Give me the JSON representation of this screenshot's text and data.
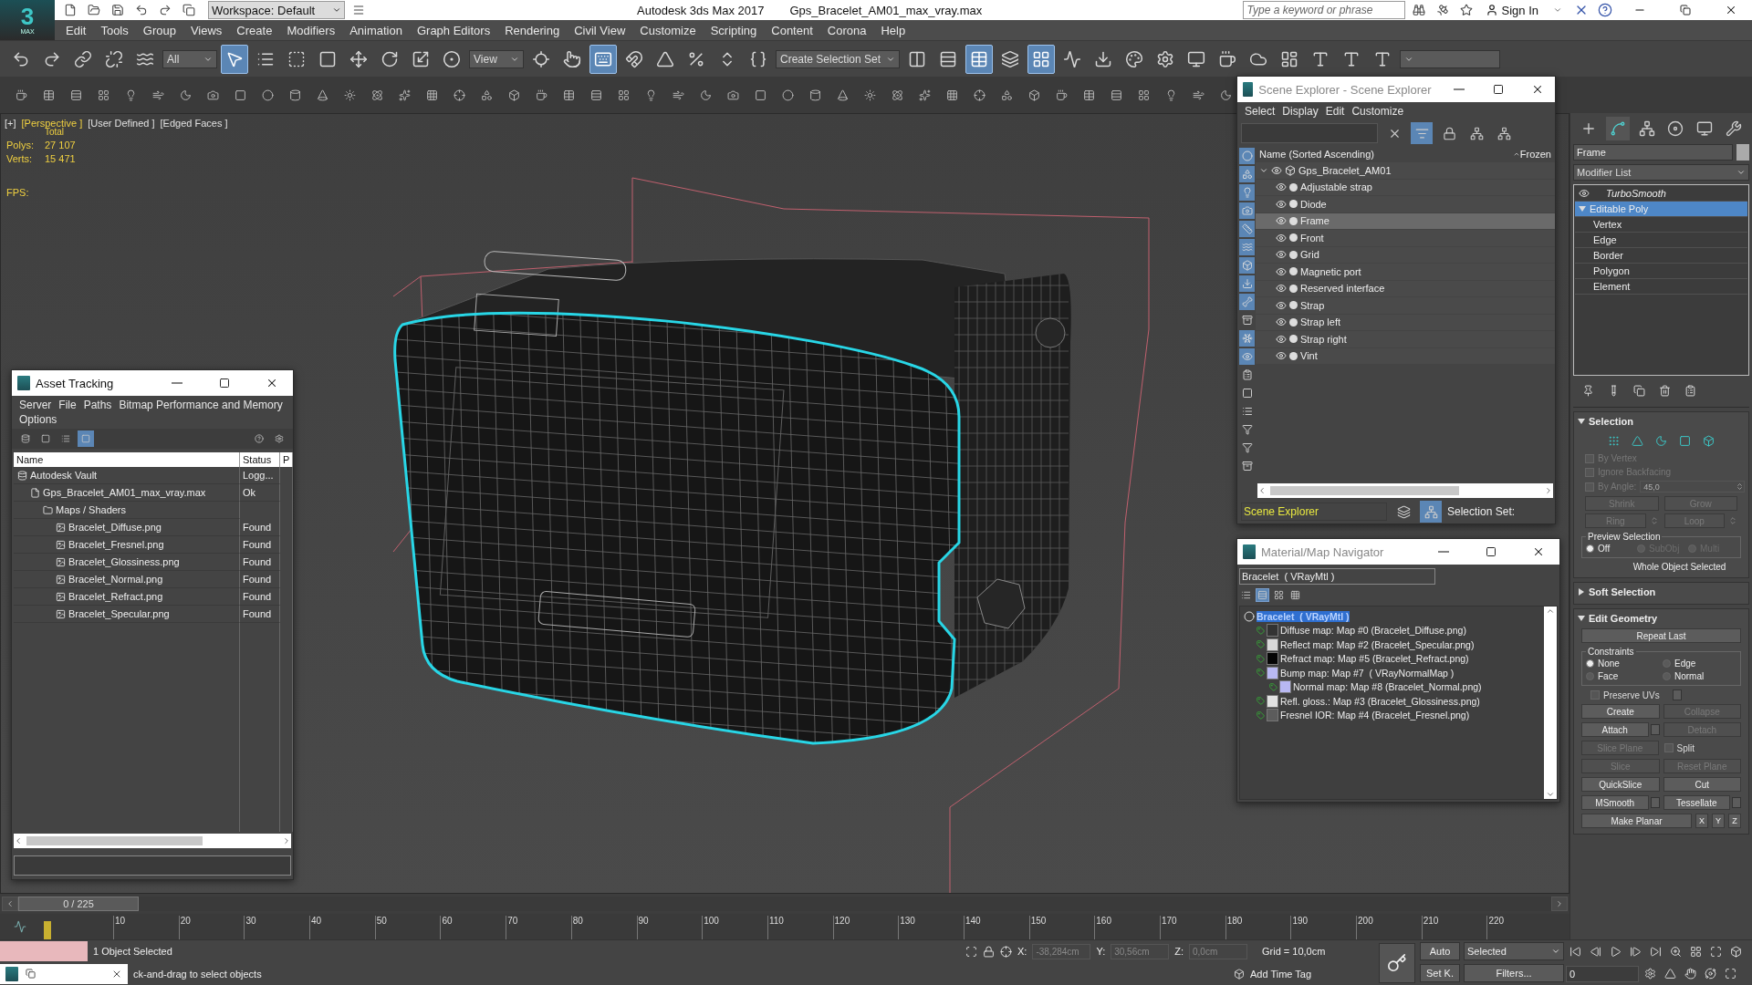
{
  "app": {
    "logo": "3",
    "logo_caption": "MAX",
    "workspace": "Workspace: Default",
    "title": "Autodesk 3ds Max 2017",
    "file": "Gps_Bracelet_AM01_max_vray.max",
    "search": {
      "placeholder": "Type a keyword or phrase"
    },
    "sign_in": "Sign In"
  },
  "menu": [
    "Edit",
    "Tools",
    "Group",
    "Views",
    "Create",
    "Modifiers",
    "Animation",
    "Graph Editors",
    "Rendering",
    "Civil View",
    "Customize",
    "Scripting",
    "Content",
    "Corona",
    "Help"
  ],
  "main_toolbar": [
    {
      "kind": "button",
      "selected": false
    },
    {
      "kind": "button",
      "selected": false
    },
    {
      "kind": "button",
      "selected": false
    },
    {
      "kind": "button",
      "selected": false
    },
    {
      "kind": "button",
      "selected": false
    },
    {
      "kind": "dropdown",
      "value": "All"
    },
    {
      "kind": "button",
      "selected": true
    },
    {
      "kind": "button",
      "selected": false
    },
    {
      "kind": "button",
      "selected": false
    },
    {
      "kind": "button",
      "selected": false
    },
    {
      "kind": "button",
      "selected": false
    },
    {
      "kind": "button",
      "selected": false
    },
    {
      "kind": "button",
      "selected": false
    },
    {
      "kind": "button",
      "selected": false
    },
    {
      "kind": "dropdown",
      "value": "View"
    },
    {
      "kind": "button",
      "selected": false
    },
    {
      "kind": "button",
      "selected": false
    },
    {
      "kind": "button",
      "selected": true
    },
    {
      "kind": "button",
      "selected": false
    },
    {
      "kind": "button",
      "selected": false
    },
    {
      "kind": "button",
      "selected": false
    },
    {
      "kind": "button",
      "selected": false
    },
    {
      "kind": "button",
      "selected": false
    },
    {
      "kind": "dropdown",
      "value": "Create Selection Set"
    },
    {
      "kind": "button",
      "selected": false
    },
    {
      "kind": "button",
      "selected": false
    },
    {
      "kind": "button",
      "selected": true
    },
    {
      "kind": "button",
      "selected": false
    },
    {
      "kind": "button",
      "selected": true
    },
    {
      "kind": "button",
      "selected": false
    },
    {
      "kind": "button",
      "selected": false
    },
    {
      "kind": "button",
      "selected": false
    },
    {
      "kind": "button",
      "selected": false
    },
    {
      "kind": "button",
      "selected": false
    },
    {
      "kind": "button",
      "selected": false
    },
    {
      "kind": "button",
      "selected": false
    },
    {
      "kind": "button",
      "selected": false
    },
    {
      "kind": "button",
      "selected": false
    },
    {
      "kind": "button",
      "selected": false
    },
    {
      "kind": "button",
      "selected": false
    },
    {
      "kind": "dropdown"
    }
  ],
  "viewport": {
    "labels": [
      {
        "text": "[+]",
        "selected": false
      },
      {
        "text": "[Perspective ]",
        "selected": true
      },
      {
        "text": "[User Defined ]",
        "selected": false
      },
      {
        "text": "[Edged Faces ]",
        "selected": false
      }
    ],
    "stats_title": "Total",
    "stats": [
      {
        "label": "Polys:",
        "value": "27 107"
      },
      {
        "label": "Verts:",
        "value": "15 471"
      }
    ],
    "fps": "FPS:"
  },
  "asset_tracking": {
    "title": "Asset Tracking",
    "menu": [
      "Server",
      "File",
      "Paths",
      "Bitmap Performance and Memory",
      "Options"
    ],
    "toolbar": [
      {
        "selected": false
      },
      {
        "selected": false
      },
      {
        "selected": false
      },
      {
        "selected": true
      },
      {
        "selected": false
      },
      {
        "selected": false
      }
    ],
    "columns": [
      "Name",
      "Status",
      "P"
    ],
    "tree": [
      {
        "kind": "vault",
        "name": "Autodesk Vault",
        "status": "Logg...",
        "children": [
          {
            "kind": "scene",
            "name": "Gps_Bracelet_AM01_max_vray.max",
            "status": "Ok",
            "children": [
              {
                "kind": "folder",
                "name": "Maps / Shaders",
                "children": [
                  {
                    "kind": "bitmap",
                    "name": "Bracelet_Diffuse.png",
                    "status": "Found"
                  },
                  {
                    "kind": "bitmap",
                    "name": "Bracelet_Fresnel.png",
                    "status": "Found"
                  },
                  {
                    "kind": "bitmap",
                    "name": "Bracelet_Glossiness.png",
                    "status": "Found"
                  },
                  {
                    "kind": "bitmap",
                    "name": "Bracelet_Normal.png",
                    "status": "Found"
                  },
                  {
                    "kind": "bitmap",
                    "name": "Bracelet_Refract.png",
                    "status": "Found"
                  },
                  {
                    "kind": "bitmap",
                    "name": "Bracelet_Specular.png",
                    "status": "Found"
                  }
                ]
              }
            ]
          }
        ]
      }
    ]
  },
  "scene_explorer": {
    "title": "Scene Explorer - Scene Explorer",
    "menu": [
      "Select",
      "Display",
      "Edit",
      "Customize"
    ],
    "tools": [
      {
        "selected": false
      },
      {
        "selected": true
      },
      {
        "selected": false
      },
      {
        "selected": false
      },
      {
        "selected": false
      }
    ],
    "side_filters": [
      {
        "selected": true
      },
      {
        "selected": true
      },
      {
        "selected": true
      },
      {
        "selected": true
      },
      {
        "selected": true
      },
      {
        "selected": true
      },
      {
        "selected": true
      },
      {
        "selected": true
      },
      {
        "selected": true
      },
      {
        "selected": false
      },
      {
        "selected": true
      },
      {
        "selected": true
      },
      {
        "selected": false
      },
      {
        "selected": false
      },
      {
        "selected": false
      },
      {
        "selected": false
      },
      {
        "selected": false
      },
      {
        "selected": false
      }
    ],
    "columns": [
      "Name (Sorted Ascending)",
      "Frozen"
    ],
    "tree": [
      {
        "name": "Gps_Bracelet_AM01",
        "kind": "group",
        "expanded": true,
        "selected": false,
        "children": [
          {
            "name": "Adjustable strap",
            "kind": "object",
            "selected": false
          },
          {
            "name": "Diode",
            "kind": "object",
            "selected": false
          },
          {
            "name": "Frame",
            "kind": "object",
            "selected": true
          },
          {
            "name": "Front",
            "kind": "object",
            "selected": false
          },
          {
            "name": "Grid",
            "kind": "object",
            "selected": false
          },
          {
            "name": "Magnetic port",
            "kind": "object",
            "selected": false
          },
          {
            "name": "Reserved interface",
            "kind": "object",
            "selected": false
          },
          {
            "name": "Strap",
            "kind": "object",
            "selected": false
          },
          {
            "name": "Strap left",
            "kind": "object",
            "selected": false
          },
          {
            "name": "Strap right",
            "kind": "object",
            "selected": false
          },
          {
            "name": "Vint",
            "kind": "object",
            "selected": false
          }
        ]
      }
    ],
    "mode": "Scene Explorer",
    "footer_tools": [
      {
        "selected": false
      },
      {
        "selected": true
      }
    ],
    "selection_set": "Selection Set:"
  },
  "material_navigator": {
    "title": "Material/Map Navigator",
    "current": "Bracelet  ( VRayMtl )",
    "view_modes": [
      {
        "selected": false
      },
      {
        "selected": true
      },
      {
        "selected": false
      },
      {
        "selected": false
      }
    ],
    "tree": [
      {
        "name": "Bracelet  ( VRayMtl )",
        "kind": "material",
        "selected": true,
        "children": [
          {
            "name": "Diffuse map: Map #0 (Bracelet_Diffuse.png)",
            "kind": "map",
            "selected": false,
            "color": "#333333"
          },
          {
            "name": "Reflect map: Map #2 (Bracelet_Specular.png)",
            "kind": "map",
            "selected": false,
            "color": "#d8d8d8"
          },
          {
            "name": "Refract map: Map #5 (Bracelet_Refract.png)",
            "kind": "map",
            "selected": false,
            "color": "#050505"
          },
          {
            "name": "Bump map: Map #7  ( VRayNormalMap )",
            "kind": "map",
            "selected": false,
            "color": "#b8b8f2",
            "children": [
              {
                "name": "Normal map: Map #8 (Bracelet_Normal.png)",
                "kind": "map",
                "selected": false,
                "color": "#b8b8f2"
              }
            ]
          },
          {
            "name": "Refl. gloss.: Map #3 (Bracelet_Glossiness.png)",
            "kind": "map",
            "selected": false,
            "color": "#e2e2e2"
          },
          {
            "name": "Fresnel IOR: Map #4 (Bracelet_Fresnel.png)",
            "kind": "map",
            "selected": false,
            "color": "#5c5c5c"
          }
        ]
      }
    ]
  },
  "command_panel": {
    "tabs": [
      {
        "selected": false
      },
      {
        "selected": true
      },
      {
        "selected": false
      },
      {
        "selected": false
      },
      {
        "selected": false
      },
      {
        "selected": false
      }
    ],
    "object_name": "Frame",
    "modifier_list": "Modifier List",
    "stack": [
      {
        "name": "TurboSmooth",
        "kind": "modifier",
        "selected": false
      },
      {
        "name": "Editable Poly",
        "kind": "base",
        "selected": true,
        "expanded": true,
        "children": [
          {
            "name": "Vertex",
            "selected": false
          },
          {
            "name": "Edge",
            "selected": false
          },
          {
            "name": "Border",
            "selected": false
          },
          {
            "name": "Polygon",
            "selected": false
          },
          {
            "name": "Element",
            "selected": false
          }
        ]
      }
    ],
    "selection": {
      "title": "Selection",
      "expanded": true,
      "checks": [
        {
          "label": "By Vertex",
          "checked": false,
          "disabled": true
        },
        {
          "label": "Ignore Backfacing",
          "checked": false,
          "disabled": true
        },
        {
          "label": "By Angle:",
          "checked": false,
          "disabled": true,
          "value": "45,0"
        }
      ],
      "buttons": [
        {
          "label": "Shrink",
          "disabled": true,
          "spinner": false
        },
        {
          "label": "Grow",
          "disabled": true,
          "spinner": false
        },
        {
          "label": "Ring",
          "disabled": true,
          "spinner": true
        },
        {
          "label": "Loop",
          "disabled": true,
          "spinner": true
        }
      ],
      "preview": {
        "title": "Preview Selection",
        "options": [
          {
            "label": "Off",
            "selected": true,
            "disabled": false
          },
          {
            "label": "SubObj",
            "selected": false,
            "disabled": true
          },
          {
            "label": "Multi",
            "selected": false,
            "disabled": true
          }
        ]
      },
      "status": "Whole Object Selected"
    },
    "soft_selection": {
      "title": "Soft Selection",
      "expanded": false
    },
    "edit_geometry": {
      "title": "Edit Geometry",
      "expanded": true,
      "repeat_last": "Repeat Last",
      "constraints": {
        "title": "Constraints",
        "options": [
          {
            "label": "None",
            "selected": true
          },
          {
            "label": "Edge",
            "selected": false
          },
          {
            "label": "Face",
            "selected": false
          },
          {
            "label": "Normal",
            "selected": false
          }
        ]
      },
      "preserve_uvs": {
        "label": "Preserve UVs",
        "checked": false,
        "settings": true
      },
      "rows": [
        [
          {
            "kind": "button",
            "label": "Create",
            "disabled": false,
            "settings": false
          },
          {
            "kind": "button",
            "label": "Collapse",
            "disabled": true,
            "settings": false
          }
        ],
        [
          {
            "kind": "button",
            "label": "Attach",
            "disabled": false,
            "settings": true
          },
          {
            "kind": "button",
            "label": "Detach",
            "disabled": true,
            "settings": false
          }
        ],
        [
          {
            "kind": "button",
            "label": "Slice Plane",
            "disabled": true,
            "settings": false
          },
          {
            "kind": "checkbox",
            "label": "Split",
            "checked": false,
            "disabled": false
          }
        ],
        [
          {
            "kind": "button",
            "label": "Slice",
            "disabled": true,
            "settings": false
          },
          {
            "kind": "button",
            "label": "Reset Plane",
            "disabled": true,
            "settings": false
          }
        ],
        [
          {
            "kind": "button",
            "label": "QuickSlice",
            "disabled": false,
            "settings": false
          },
          {
            "kind": "button",
            "label": "Cut",
            "disabled": false,
            "settings": false
          }
        ],
        [
          {
            "kind": "button",
            "label": "MSmooth",
            "disabled": false,
            "settings": true
          },
          {
            "kind": "button",
            "label": "Tessellate",
            "disabled": false,
            "settings": true
          }
        ],
        [
          {
            "kind": "button",
            "label": "Make Planar",
            "disabled": false,
            "settings": false
          },
          {
            "kind": "small",
            "label": "X",
            "disabled": false
          },
          {
            "kind": "small",
            "label": "Y",
            "disabled": false
          },
          {
            "kind": "small",
            "label": "Z",
            "disabled": false
          }
        ]
      ]
    }
  },
  "timeline": {
    "position": "0 / 225",
    "level": 0,
    "ticks": [
      "10",
      "20",
      "30",
      "40",
      "50",
      "60",
      "70",
      "80",
      "90",
      "100",
      "110",
      "120",
      "130",
      "140",
      "150",
      "160",
      "170",
      "180",
      "190",
      "200",
      "210",
      "220"
    ]
  },
  "status_bar": {
    "selection": "1 Object Selected",
    "prompt": "ck-and-drag to select objects",
    "coords": [
      {
        "label": "X:",
        "value": "-38,284cm"
      },
      {
        "label": "Y:",
        "value": "30,56cm"
      },
      {
        "label": "Z:",
        "value": "0,0cm"
      }
    ],
    "grid": "Grid = 10,0cm",
    "time_tag": "Add Time Tag",
    "auto_key": "Auto",
    "set_key": "Set K.",
    "key_filter": "Selected",
    "filters": "Filters...",
    "frame": "0"
  }
}
